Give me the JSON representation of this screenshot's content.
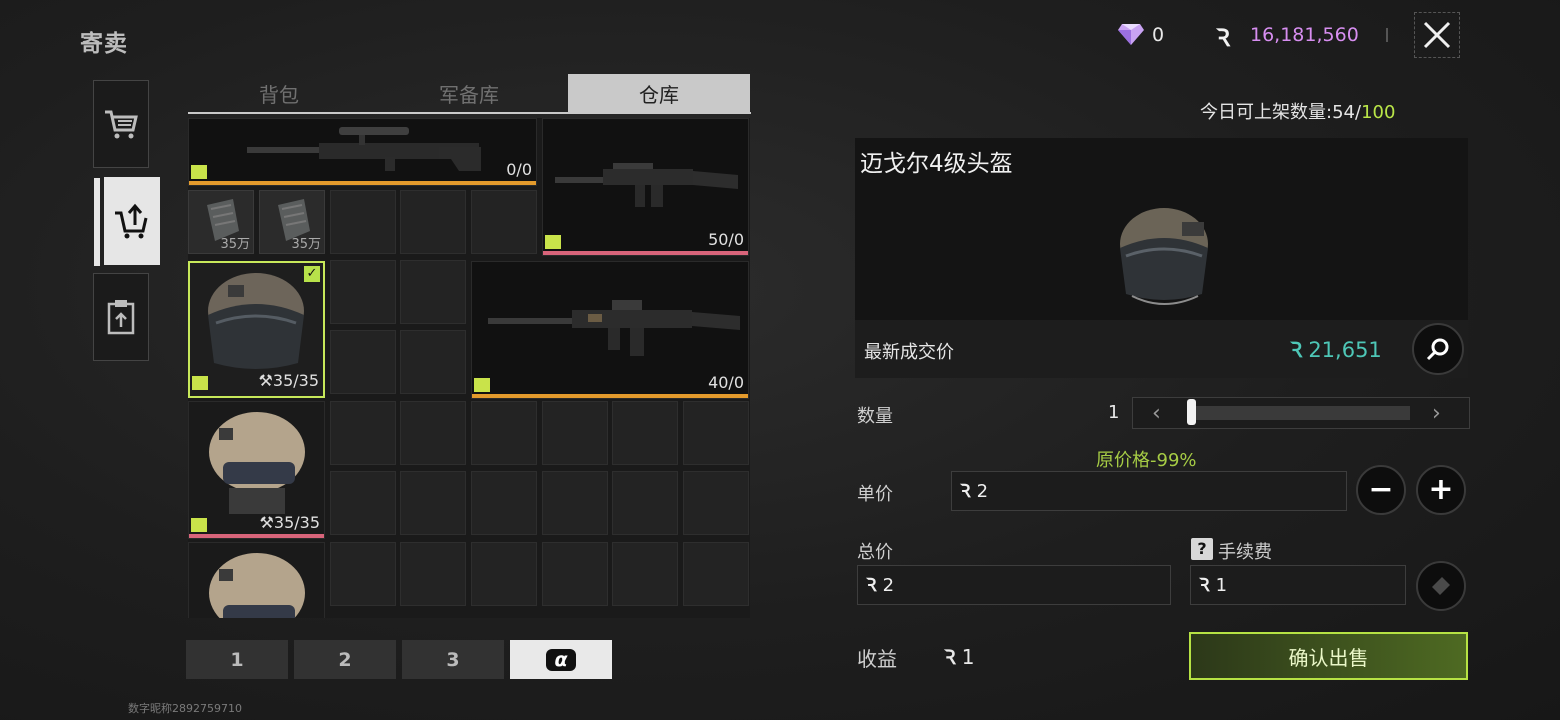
{
  "header": {
    "title": "寄卖",
    "gem_count": "0",
    "money_icon": "Ꝛ",
    "money": "16,181,560"
  },
  "side_tabs": [
    {
      "name": "buy",
      "icon": "cart-icon"
    },
    {
      "name": "sell",
      "icon": "cart-upload-icon"
    },
    {
      "name": "listings",
      "icon": "clipboard-icon"
    }
  ],
  "storage_tabs": [
    {
      "label": "背包",
      "active": false
    },
    {
      "label": "军备库",
      "active": false
    },
    {
      "label": "仓库",
      "active": true
    }
  ],
  "grid": {
    "items": [
      {
        "name": "sniper-rifle",
        "count": "0/0"
      },
      {
        "name": "assault-rifle-1",
        "count": "50/0"
      },
      {
        "name": "helmet-selected",
        "count": "35/35"
      },
      {
        "name": "assault-rifle-2",
        "count": "40/0"
      },
      {
        "name": "helmet-2",
        "count": "35/35"
      }
    ],
    "small_items": [
      {
        "price": "35万"
      },
      {
        "price": "35万"
      }
    ]
  },
  "pages": [
    "1",
    "2",
    "3",
    "α"
  ],
  "watermark": "数字昵称2892759710",
  "panel": {
    "limit_label": "今日可上架数量:",
    "limit_current": "54",
    "limit_sep": "/",
    "limit_max": "100",
    "item_name": "迈戈尔4级头盔",
    "last_price_label": "最新成交价",
    "last_price": "21,651",
    "qty_label": "数量",
    "qty_value": "1",
    "discount": "原价格-99%",
    "unit_price_label": "单价",
    "unit_price": "2",
    "total_label": "总价",
    "total": "2",
    "fee_label": "手续费",
    "fee_help": "?",
    "fee": "1",
    "profit_label": "收益",
    "profit": "1",
    "confirm": "确认出售",
    "minus": "−",
    "plus": "+"
  },
  "colors": {
    "accent_green": "#b6e244",
    "money_purple": "#d78ef0",
    "price_teal": "#4ec7b7",
    "bar_orange": "#e39a2c",
    "bar_pink": "#d8647a"
  }
}
